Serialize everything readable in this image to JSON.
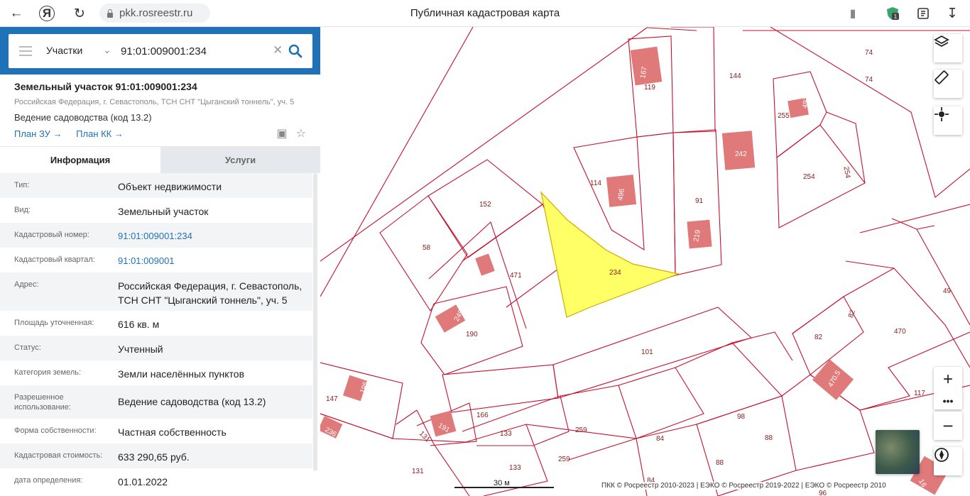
{
  "browser": {
    "url": "pkk.rosreestr.ru",
    "title": "Публичная кадастровая карта",
    "yandex_glyph": "Я"
  },
  "search": {
    "type": "Участки",
    "value": "91:01:009001:234"
  },
  "object": {
    "title": "Земельный участок 91:01:009001:234",
    "address": "Российская Федерация, г. Севастополь, ТСН СНТ \"Цыганский тоннель\", уч. 5",
    "usage": "Ведение садоводства (код 13.2)",
    "link_plan_zu": "План ЗУ →",
    "link_plan_kk": "План КК →"
  },
  "tabs": {
    "info": "Информация",
    "services": "Услуги"
  },
  "info": [
    {
      "key": "Тип:",
      "value": "Объект недвижимости"
    },
    {
      "key": "Вид:",
      "value": "Земельный участок"
    },
    {
      "key": "Кадастровый номер:",
      "value": "91:01:009001:234"
    },
    {
      "key": "Кадастровый квартал:",
      "value": "91:01:009001"
    },
    {
      "key": "Адрес:",
      "value": "Российская Федерация, г. Севастополь, ТСН СНТ \"Цыганский тоннель\", уч. 5"
    },
    {
      "key": "Площадь уточненная:",
      "value": "616 кв. м"
    },
    {
      "key": "Статус:",
      "value": "Учтенный"
    },
    {
      "key": "Категория земель:",
      "value": "Земли населённых пунктов"
    },
    {
      "key": "Разрешенное использование:",
      "value": "Ведение садоводства (код 13.2)"
    },
    {
      "key": "Форма собственности:",
      "value": "Частная собственность"
    },
    {
      "key": "Кадастровая стоимость:",
      "value": "633 290,65 руб."
    },
    {
      "key": "дата определения:",
      "value": "01.01.2022"
    }
  ],
  "map": {
    "parcel_labels": [
      "74",
      "74",
      "167",
      "119",
      "144",
      "255",
      "492",
      "242",
      "114",
      "496",
      "152",
      "91",
      "254",
      "254",
      "58",
      "471",
      "234",
      "219",
      "49",
      "249",
      "190",
      "82",
      "82",
      "470",
      "101",
      "195",
      "147",
      "470.5",
      "166",
      "191",
      "236",
      "117",
      "98",
      "131",
      "133",
      "259",
      "84",
      "88",
      "133",
      "259",
      "131",
      "88",
      "84",
      "96",
      "16"
    ],
    "scale": "30 м",
    "copyright": "ПКК © Росреестр 2010-2023 | ЕЭКО © Росреестр 2019-2022 | ЕЭКО © Росреестр 2010",
    "selected_color": "#ffff66",
    "border_color": "#c8102e",
    "building_color": "#e07a7a"
  }
}
